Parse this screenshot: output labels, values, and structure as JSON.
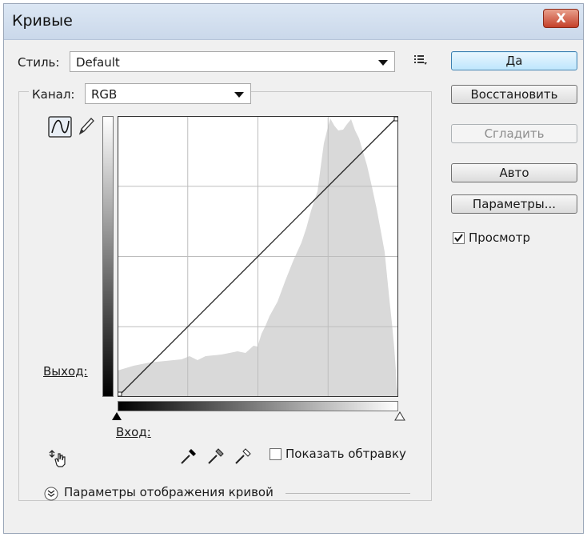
{
  "window": {
    "title": "Кривые",
    "close_label": "X"
  },
  "style": {
    "label": "Стиль:",
    "value": "Default",
    "menu_icon": "list-options-icon"
  },
  "channel": {
    "label": "Канал:",
    "value": "RGB"
  },
  "tools": {
    "curve_tool": "curve-icon",
    "pencil_tool": "pencil-icon",
    "target_adjust_tool": "hand-adjust-icon"
  },
  "graph": {
    "output_label": "Выход:",
    "input_label": "Вход:",
    "grid_divisions": 4
  },
  "buttons": {
    "ok": "Да",
    "reset": "Восстановить",
    "smooth": "Сгладить",
    "auto": "Авто",
    "options": "Параметры..."
  },
  "preview": {
    "label": "Просмотр",
    "checked": true
  },
  "eyedroppers": [
    "black-point-eyedropper-icon",
    "gray-point-eyedropper-icon",
    "white-point-eyedropper-icon"
  ],
  "show_clipping": {
    "label": "Показать обтравку",
    "checked": false
  },
  "curve_display_options": {
    "label": "Параметры отображения кривой"
  }
}
